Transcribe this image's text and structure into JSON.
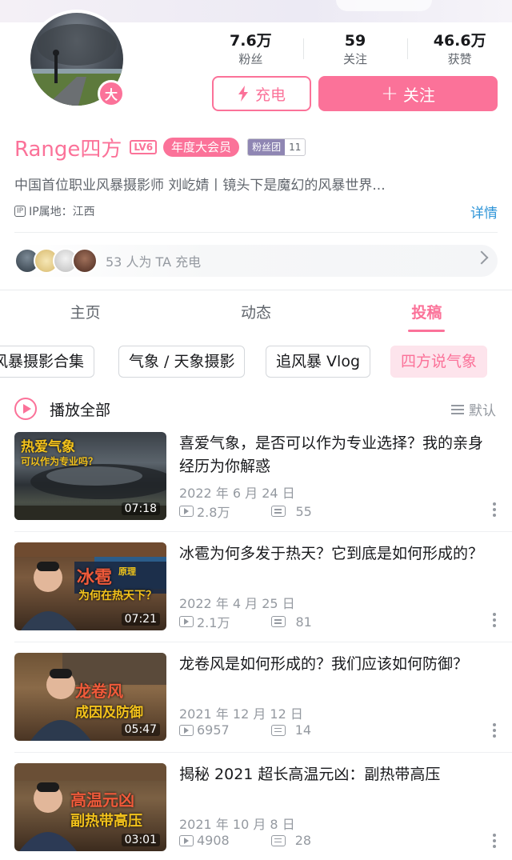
{
  "profile": {
    "level_badge": "大",
    "stats": [
      {
        "value": "7.6万",
        "label": "粉丝"
      },
      {
        "value": "59",
        "label": "关注"
      },
      {
        "value": "46.6万",
        "label": "获赞"
      }
    ],
    "charge_label": "充电",
    "follow_label": "关注",
    "username": "Range四方",
    "level_tag": "LV6",
    "vip_tag": "年度大会员",
    "fan_group": {
      "label": "粉丝团",
      "count": "11"
    },
    "bio": "中国首位职业风暴摄影师 刘屹婧丨镜头下是魔幻的风暴世界...",
    "ip_icon": "IP",
    "ip_location": "IP属地：江西",
    "detail_link": "详情",
    "charge_summary": "53 人为 TA 充电"
  },
  "tabs": [
    {
      "label": "主页",
      "active": false
    },
    {
      "label": "动态",
      "active": false
    },
    {
      "label": "投稿",
      "active": true
    }
  ],
  "collections": [
    {
      "label": "风暴摄影合集",
      "active": false
    },
    {
      "label": "气象 / 天象摄影",
      "active": false
    },
    {
      "label": "追风暴 Vlog",
      "active": false
    },
    {
      "label": "四方说气象",
      "active": true
    }
  ],
  "list_header": {
    "play_all": "播放全部",
    "sort": "默认"
  },
  "videos": [
    {
      "title": "喜爱气象，是否可以作为专业选择？我的亲身经历为你解惑",
      "date": "2022 年 6 月 24 日",
      "plays": "2.8万",
      "danmaku": "55",
      "duration": "07:18",
      "thumb_text_1": "热爱气象",
      "thumb_text_2": "可以作为专业吗？"
    },
    {
      "title": "冰雹为何多发于热天？它到底是如何形成的？",
      "date": "2022 年 4 月 25 日",
      "plays": "2.1万",
      "danmaku": "81",
      "duration": "07:21",
      "thumb_text_1": "冰雹",
      "thumb_text_1b": "原理",
      "thumb_text_2": "为何在热天下？"
    },
    {
      "title": "龙卷风是如何形成的？我们应该如何防御？",
      "date": "2021 年 12 月 12 日",
      "plays": "6957",
      "danmaku": "14",
      "duration": "05:47",
      "thumb_text_1": "龙卷风",
      "thumb_text_2": "成因及防御"
    },
    {
      "title": "揭秘 2021 超长高温元凶：副热带高压",
      "date": "2021 年 10 月 8 日",
      "plays": "4908",
      "danmaku": "28",
      "duration": "03:01",
      "thumb_text_1": "高温元凶",
      "thumb_text_2": "副热带高压"
    }
  ],
  "colors": {
    "accent": "#fb7299",
    "link": "#2f95d8",
    "muted": "#9499a0"
  }
}
